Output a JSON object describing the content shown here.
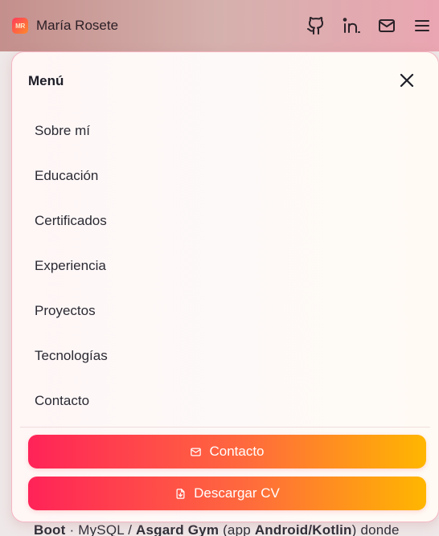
{
  "header": {
    "logo_text": "MR",
    "name": "María Rosete",
    "icons": [
      "github-icon",
      "linkedin-icon",
      "mail-icon",
      "menu-icon"
    ]
  },
  "menu": {
    "title": "Menú",
    "close_icon": "close-icon",
    "items": [
      {
        "label": "Sobre mí"
      },
      {
        "label": "Educación"
      },
      {
        "label": "Certificados"
      },
      {
        "label": "Experiencia"
      },
      {
        "label": "Proyectos"
      },
      {
        "label": "Tecnologías"
      },
      {
        "label": "Contacto"
      }
    ],
    "buttons": {
      "contact_label": "Contacto",
      "contact_icon": "mail-icon",
      "cv_label": "Descargar CV",
      "cv_icon": "file-download-icon"
    }
  },
  "background_text": {
    "part1": "Boot",
    "part2": " · MySQL / ",
    "part3": "Asgard Gym",
    "part4": " (app ",
    "part5": "Android/Kotlin",
    "part6": ") donde"
  },
  "colors": {
    "gradient_start": "#ff2358",
    "gradient_end": "#ffb600",
    "panel_border": "#f5b6c2"
  }
}
